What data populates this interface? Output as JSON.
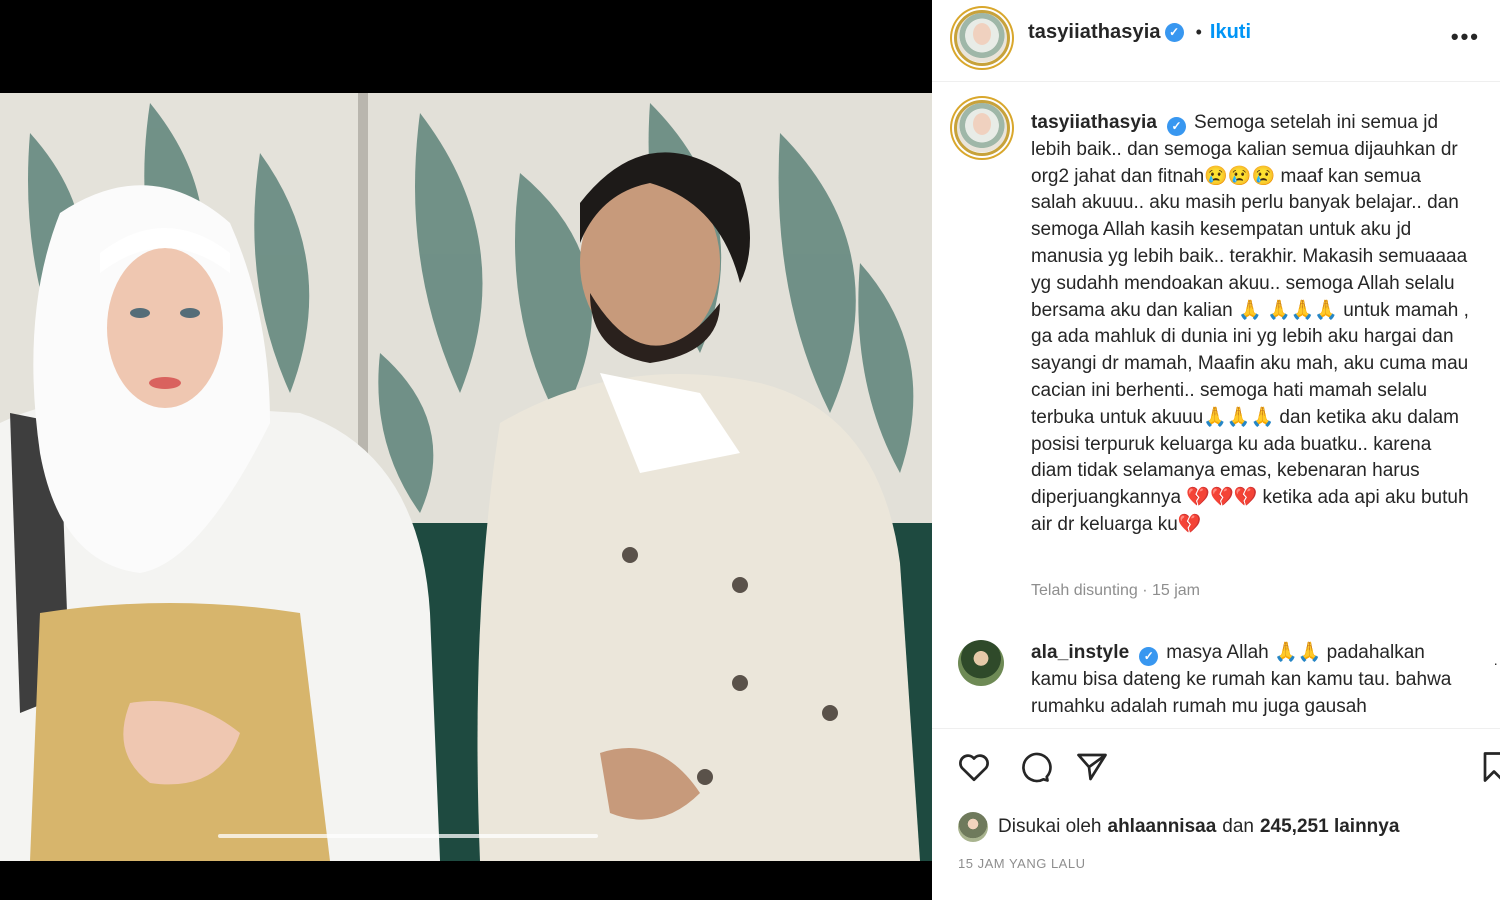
{
  "post": {
    "username": "tasyiiathasyia",
    "follow_label": "Ikuti",
    "separator": "•",
    "more_label": "•••"
  },
  "caption": {
    "username": "tasyiiathasyia",
    "text": "Semoga setelah ini semua jd lebih baik.. dan semoga kalian semua dijauhkan dr org2 jahat dan fitnah😢😢😢 maaf kan semua salah akuuu.. aku masih perlu banyak belajar.. dan semoga Allah kasih kesempatan untuk aku jd manusia yg lebih baik.. terakhir. Makasih semuaaaa yg sudahh mendoakan akuu.. semoga Allah selalu bersama aku dan kalian 🙏 🙏🙏🙏 untuk mamah , ga ada mahluk di dunia ini yg lebih aku hargai dan sayangi dr mamah, Maafin aku mah, aku cuma mau cacian ini berhenti.. semoga hati mamah selalu terbuka untuk akuuu🙏🙏🙏 dan ketika aku dalam posisi terpuruk keluarga ku ada buatku.. karena diam tidak selamanya emas, kebenaran harus diperjuangkannya 💔💔💔 ketika ada api aku butuh air dr keluarga ku💔",
    "edited_label": "Telah disunting · 15 jam"
  },
  "comment": {
    "username": "ala_instyle",
    "text": "masya Allah 🙏🙏 padahalkan kamu bisa dateng ke rumah kan kamu tau. bahwa rumahku adalah rumah mu juga gausah"
  },
  "actions": {
    "like_icon": "heart-icon",
    "comment_icon": "speech-bubble-icon",
    "share_icon": "paper-plane-icon",
    "save_icon": "bookmark-icon"
  },
  "likes": {
    "prefix": "Disukai oleh",
    "user": "ahlaannisaa",
    "middle": "dan",
    "count": "245,251 lainnya"
  },
  "time_ago": "15 JAM YANG LALU",
  "colors": {
    "accent": "#0095f6",
    "verified": "#3897f0",
    "text": "#262626",
    "muted": "#8e8e8e"
  }
}
